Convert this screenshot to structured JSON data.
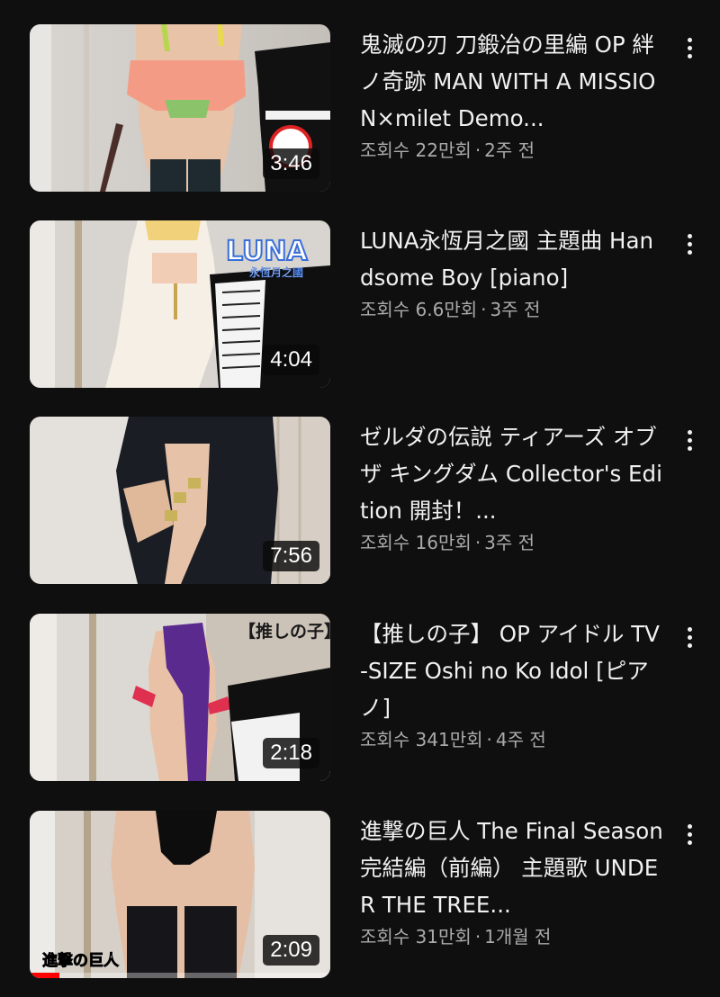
{
  "videos": [
    {
      "title": "鬼滅の刃 刀鍛冶の里編 OP 絆ノ奇跡 MAN WITH A MISSION×milet Demo...",
      "views": "조회수 22만회",
      "age": "2주 전",
      "duration": "3:46",
      "progress": 0
    },
    {
      "title": "LUNA永恆月之國 主題曲 Handsome Boy [piano]",
      "views": "조회수 6.6만회",
      "age": "3주 전",
      "duration": "4:04",
      "progress": 0,
      "overlay_text": "LUNA 永恆月之國"
    },
    {
      "title": "ゼルダの伝説 ティアーズ オブ ザ キングダム Collector's Edition 開封！...",
      "views": "조회수 16만회",
      "age": "3주 전",
      "duration": "7:56",
      "progress": 0
    },
    {
      "title": "【推しの子】 OP アイドル TV-SIZE Oshi no Ko Idol [ピアノ]",
      "views": "조회수 341만회",
      "age": "4주 전",
      "duration": "2:18",
      "progress": 0,
      "overlay_text": "【推しの子】"
    },
    {
      "title": "進撃の巨人 The Final Season 完結編（前編） 主題歌 UNDER THE TREE...",
      "views": "조회수 31만회",
      "age": "1개월 전",
      "duration": "2:09",
      "progress": 0.1,
      "overlay_text": "進撃の巨人"
    }
  ],
  "separator": "·",
  "icons": {
    "more": "more-vertical-icon"
  },
  "colors": {
    "background": "#0f0f0f",
    "title": "#f1f1f1",
    "meta": "#aaaaaa",
    "progress": "#ff0000"
  }
}
